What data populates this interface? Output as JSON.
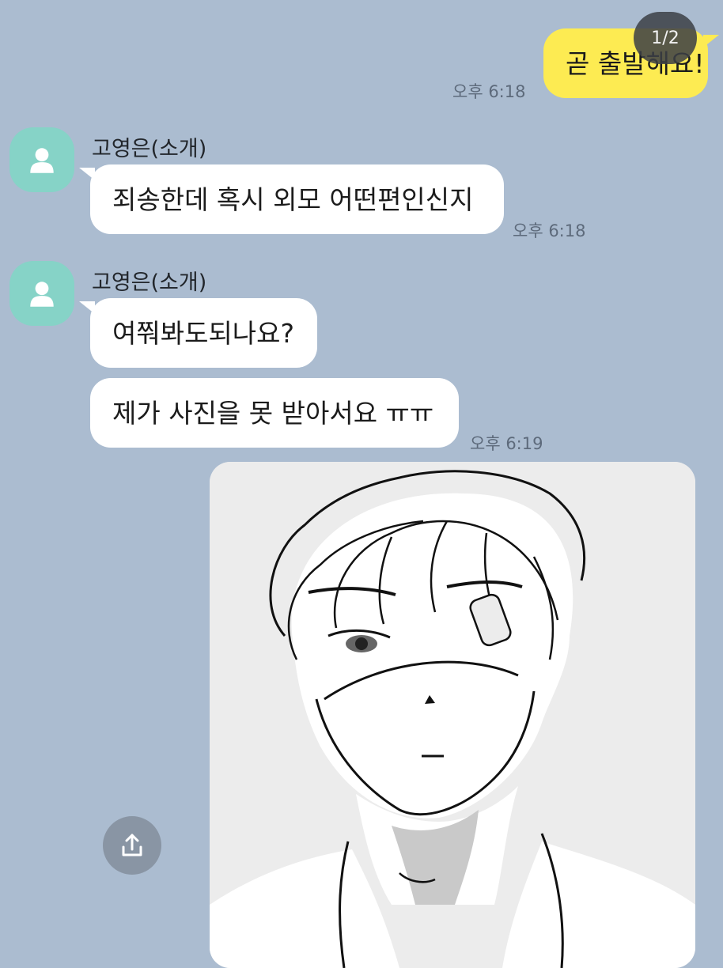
{
  "image_counter": "1/2",
  "messages": [
    {
      "sender": "me",
      "text": "곧 출발해요!",
      "time": "오후 6:18"
    },
    {
      "sender": "고영은(소개)",
      "text": "죄송한데 혹시 외모 어떤편인신지",
      "time": "오후 6:18"
    },
    {
      "sender": "고영은(소개)",
      "text": "여쭤봐도되나요?"
    },
    {
      "sender": "고영은(소개)",
      "text": "제가 사진을 못 받아서요 ㅠㅠ",
      "time": "오후 6:19"
    }
  ],
  "attachment": {
    "type": "image",
    "subject": "line-drawing-portrait"
  },
  "icons": {
    "avatar": "person-icon",
    "share": "share-upload-icon"
  },
  "colors": {
    "background": "#abbcd0",
    "my_bubble": "#fdeb52",
    "their_bubble": "#ffffff",
    "avatar": "#86d3c7"
  }
}
